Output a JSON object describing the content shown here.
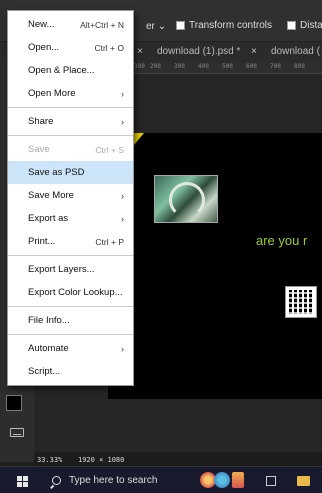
{
  "options_bar": {
    "dropdown_label": "er",
    "checks": [
      "Transform controls",
      "Dista"
    ]
  },
  "tabs": [
    {
      "label": "download (1).psd *",
      "close": "×"
    },
    {
      "label": "download (",
      "close": ""
    }
  ],
  "tab_close_first": "×",
  "ruler_ticks": [
    "300",
    "200",
    "300",
    "400",
    "500",
    "600",
    "700",
    "800"
  ],
  "menu": {
    "items": [
      {
        "label": "New...",
        "shortcut": "Alt+Ctrl + N"
      },
      {
        "label": "Open...",
        "shortcut": "Ctrl + O"
      },
      {
        "label": "Open & Place...",
        "shortcut": ""
      },
      {
        "label": "Open More",
        "shortcut": "›"
      },
      {
        "label": "Share",
        "shortcut": "›"
      },
      {
        "label": "Save",
        "shortcut": "Ctrl + S"
      },
      {
        "label": "Save as PSD",
        "shortcut": ""
      },
      {
        "label": "Save More",
        "shortcut": "›"
      },
      {
        "label": "Export as",
        "shortcut": "›"
      },
      {
        "label": "Print...",
        "shortcut": "Ctrl + P"
      },
      {
        "label": "Export Layers...",
        "shortcut": ""
      },
      {
        "label": "Export Color Lookup...",
        "shortcut": ""
      },
      {
        "label": "File Info...",
        "shortcut": ""
      },
      {
        "label": "Automate",
        "shortcut": "›"
      },
      {
        "label": "Script...",
        "shortcut": ""
      }
    ]
  },
  "canvas": {
    "text": "are you r"
  },
  "status": {
    "zoom": "33.33%",
    "size": "1920 × 1080"
  },
  "taskbar": {
    "search_placeholder": "Type here to search"
  },
  "colors": {
    "menu_highlight": "#cce4f7",
    "canvas_text": "#9acd32"
  }
}
